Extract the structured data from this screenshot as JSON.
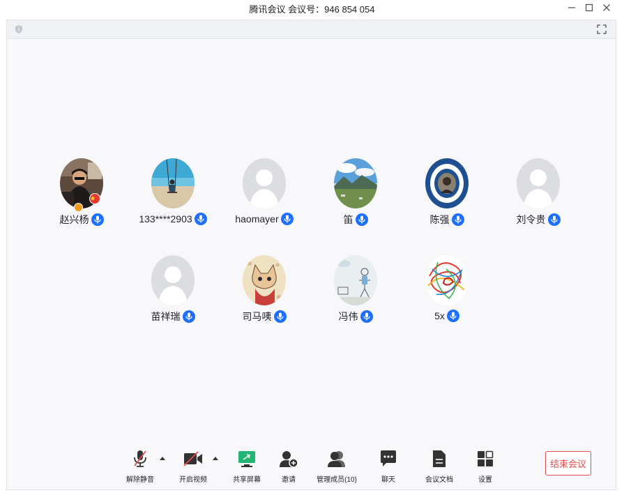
{
  "window": {
    "title": "腾讯会议 会议号：946 854 054",
    "controls": [
      "minimize-icon",
      "maximize-icon",
      "close-icon"
    ]
  },
  "colors": {
    "mic_active": "#1e6fff",
    "end_button": "#e34d4d",
    "screen_share": "#22b573",
    "host_badge": "#f29a1a"
  },
  "participants": [
    {
      "name": "赵兴杨",
      "avatar": "photo-man-room",
      "badges": [
        "host",
        "flag"
      ]
    },
    {
      "name": "133****2903",
      "avatar": "photo-beach-swing"
    },
    {
      "name": "haomayer",
      "avatar": "default-avatar"
    },
    {
      "name": "笛",
      "avatar": "photo-mountain-landscape"
    },
    {
      "name": "陈强",
      "avatar": "emblem-seal"
    },
    {
      "name": "刘令贵",
      "avatar": "default-avatar"
    },
    {
      "name": "苗祥瑞",
      "avatar": "default-avatar"
    },
    {
      "name": "司马咦",
      "avatar": "cartoon-cat"
    },
    {
      "name": "冯伟",
      "avatar": "child-drawing"
    },
    {
      "name": "5x",
      "avatar": "colorful-scribble"
    }
  ],
  "toolbar": {
    "unmute": "解除静音",
    "start_video": "开启视频",
    "share_screen": "共享屏幕",
    "invite": "邀请",
    "manage_members": "管理成员(10)",
    "chat": "聊天",
    "meeting_docs": "会议文档",
    "settings": "设置",
    "end_meeting": "结束会议"
  }
}
